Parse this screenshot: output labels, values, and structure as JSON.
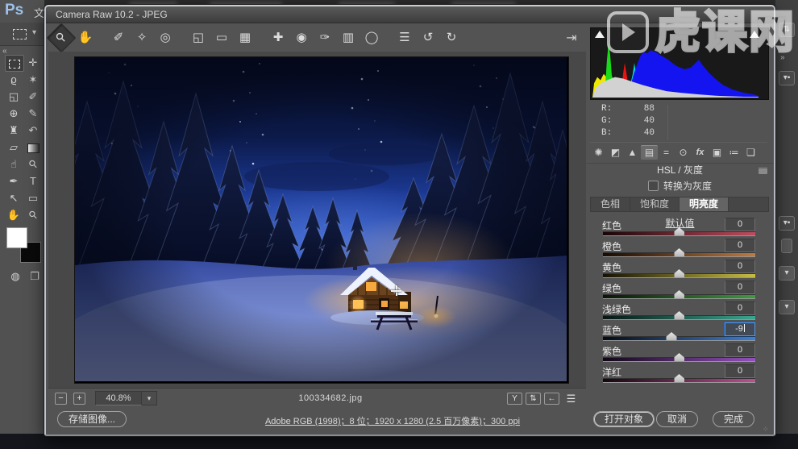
{
  "photoshop": {
    "logo": "Ps",
    "menu_partial": "文",
    "selected_tool": "rectangular-marquee",
    "tool_rows": [
      [
        "rectangular-marquee",
        "move"
      ],
      [
        "lasso",
        "magic-wand"
      ],
      [
        "crop",
        "eyedropper"
      ],
      [
        "healing-brush",
        "brush"
      ],
      [
        "clone-stamp",
        "history-brush"
      ],
      [
        "eraser",
        "gradient"
      ],
      [
        "smudge",
        "dodge"
      ],
      [
        "pen",
        "type"
      ],
      [
        "path-selection",
        "shape"
      ],
      [
        "hand",
        "zoom"
      ]
    ],
    "bottom_tools": [
      "quick-mask",
      "screen-mode"
    ]
  },
  "watermark": {
    "text": "虎课网"
  },
  "dialog": {
    "title": "Camera Raw 10.2 -  JPEG",
    "toolbar": {
      "selected": "zoom",
      "tools": [
        "zoom",
        "hand",
        "white-balance",
        "color-sampler",
        "targeted-adjustment",
        "crop",
        "straighten",
        "transform",
        "spot-removal",
        "red-eye",
        "adjustment-brush",
        "graduated-filter",
        "radial-filter",
        "preferences",
        "rotate-left",
        "rotate-right"
      ]
    },
    "histogram": {
      "channels": [
        "#f0e800",
        "#18dc18",
        "#e81414",
        "#00dcdc",
        "#1414f0",
        "#d2d2d2"
      ],
      "rgb_readout": [
        {
          "label": "R:",
          "value": "88"
        },
        {
          "label": "G:",
          "value": "40"
        },
        {
          "label": "B:",
          "value": "40"
        }
      ]
    },
    "panel": {
      "tab_icons": [
        "basic",
        "tone-curve",
        "detail",
        "hsl-grayscale",
        "split-toning",
        "lens-corrections",
        "effects",
        "camera-calibration",
        "presets",
        "snapshots"
      ],
      "active_tab_icon": "hsl-grayscale",
      "title": "HSL / 灰度",
      "grayscale_checkbox_label": "转换为灰度",
      "grayscale_checked": false,
      "tabs": [
        "色相",
        "饱和度",
        "明亮度"
      ],
      "active_tab": "明亮度",
      "default_link": "默认值",
      "sliders": [
        {
          "label": "红色",
          "value": "0",
          "track": [
            "#1a0406",
            "#c04b5e"
          ],
          "pos": 50,
          "active": false
        },
        {
          "label": "橙色",
          "value": "0",
          "track": [
            "#160a02",
            "#bf7a40"
          ],
          "pos": 50,
          "active": false
        },
        {
          "label": "黄色",
          "value": "0",
          "track": [
            "#151204",
            "#c6bc45"
          ],
          "pos": 50,
          "active": false
        },
        {
          "label": "绿色",
          "value": "0",
          "track": [
            "#0a1406",
            "#3f9a40"
          ],
          "pos": 50,
          "active": false
        },
        {
          "label": "浅绿色",
          "value": "0",
          "track": [
            "#061512",
            "#3aa690"
          ],
          "pos": 50,
          "active": false
        },
        {
          "label": "蓝色",
          "value": "-9",
          "track": [
            "#050a14",
            "#4080cf"
          ],
          "pos": 45,
          "active": true
        },
        {
          "label": "紫色",
          "value": "0",
          "track": [
            "#0f0616",
            "#9550bd"
          ],
          "pos": 50,
          "active": false
        },
        {
          "label": "洋红",
          "value": "0",
          "track": [
            "#150510",
            "#bd4f93"
          ],
          "pos": 50,
          "active": false
        }
      ]
    },
    "statusbar": {
      "zoom_out": "−",
      "zoom_in": "+",
      "zoom_level": "40.8%",
      "filename": "100334682.jpg",
      "preview_buttons": [
        "y-preview",
        "swap-views",
        "copy-settings",
        "preview-settings"
      ]
    },
    "footer": {
      "save_button": "存储图像...",
      "info_link": "Adobe RGB (1998)；8 位；1920 x 1280 (2.5 百万像素)；300 ppi",
      "open_button": "打开对象",
      "cancel_button": "取消",
      "done_button": "完成"
    }
  }
}
